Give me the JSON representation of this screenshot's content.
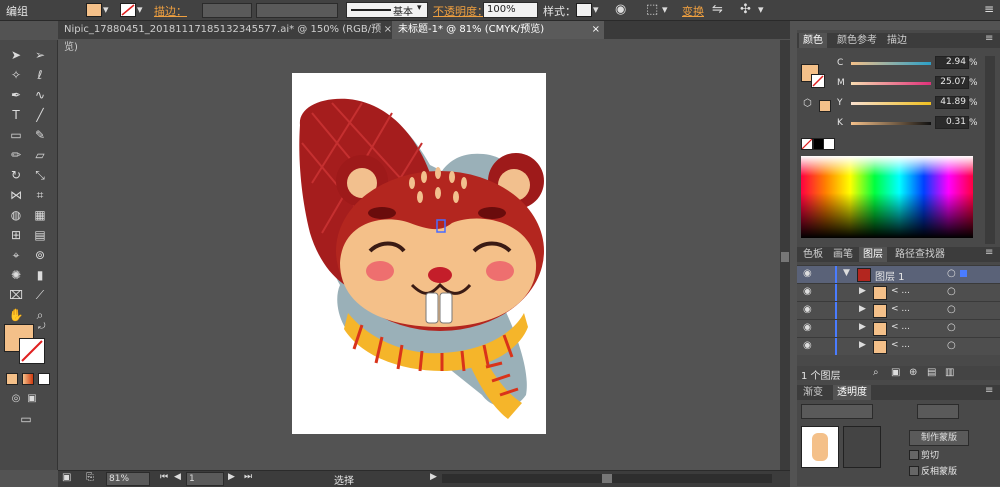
{
  "controlbar": {
    "group_label": "编组",
    "stroke_label": "描边：",
    "line_style": "基本",
    "opacity_label": "不透明度：",
    "opacity_value": "100%",
    "style_label": "样式：",
    "transform_label": "变换",
    "fill_color": "#f4c089"
  },
  "tabs": [
    {
      "label": "Nipic_17880451_20181117185132345577.ai* @ 150% (RGB/预览)"
    },
    {
      "label": "未标题-1* @ 81% (CMYK/预览)"
    }
  ],
  "tab_close": "×",
  "status": {
    "zoom": "81%",
    "page": "1",
    "mode": "选择"
  },
  "color_panel": {
    "tabs": [
      "颜色",
      "颜色参考",
      "描边"
    ],
    "channels": [
      {
        "name": "C",
        "value": "2.94"
      },
      {
        "name": "M",
        "value": "25.07"
      },
      {
        "name": "Y",
        "value": "41.89"
      },
      {
        "name": "K",
        "value": "0.31"
      }
    ],
    "unit": "%"
  },
  "layers_panel": {
    "tabs": [
      "色板",
      "画笔",
      "图层",
      "路径查找器"
    ],
    "layer_name": "图层 1",
    "sublayer_label": "< ...",
    "count": "1 个图层"
  },
  "bottom_panel": {
    "tabs": [
      "渐变",
      "透明度"
    ],
    "mask_button": "制作蒙版",
    "clip_label": "剪切",
    "invert_label": "反相蒙版"
  },
  "colors": {
    "accent": "#f4c089",
    "panel_bg": "#494949",
    "canvas_bg": "#535353"
  }
}
